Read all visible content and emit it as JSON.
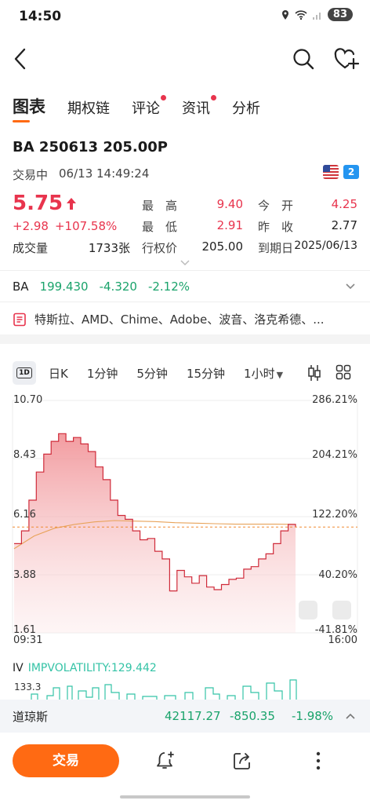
{
  "status_bar": {
    "time": "14:50",
    "wifi": "6",
    "battery": "83"
  },
  "tabs": [
    {
      "label": "图表",
      "active": true,
      "dot": false
    },
    {
      "label": "期权链",
      "active": false,
      "dot": false
    },
    {
      "label": "评论",
      "active": false,
      "dot": true
    },
    {
      "label": "资讯",
      "active": false,
      "dot": true
    },
    {
      "label": "分析",
      "active": false,
      "dot": false
    }
  ],
  "contract": {
    "symbol": "BA 250613 205.00P",
    "status": "交易中",
    "timestamp": "06/13 14:49:24",
    "badge": "2",
    "price": "5.75",
    "change": "+2.98",
    "change_pct": "+107.58%",
    "volume_label": "成交量",
    "volume": "1733张"
  },
  "stats": {
    "high_label": "最　高",
    "high": "9.40",
    "open_label": "今　开",
    "open": "4.25",
    "low_label": "最　低",
    "low": "2.91",
    "prev_close_label": "昨　收",
    "prev_close": "2.77",
    "strike_label": "行权价",
    "strike": "205.00",
    "expiry_label": "到期日",
    "expiry": "2025/06/13"
  },
  "underlying": {
    "symbol": "BA",
    "price": "199.430",
    "change": "-4.320",
    "change_pct": "-2.12%"
  },
  "related": {
    "text": "特斯拉、AMD、Chime、Adobe、波音、洛克希德、..."
  },
  "chart_tabs": {
    "day": "1D",
    "k": "日K",
    "m1": "1分钟",
    "m5": "5分钟",
    "m15": "15分钟",
    "h1": "1小时"
  },
  "chart_data": {
    "type": "area",
    "y_left_ticks": [
      "10.70",
      "8.43",
      "6.16",
      "3.88",
      "1.61"
    ],
    "y_right_ticks": [
      "286.21%",
      "204.21%",
      "122.20%",
      "40.20%",
      "-41.81%"
    ],
    "x_labels": [
      "09:31",
      "16:00"
    ],
    "ylim": [
      1.61,
      10.7
    ],
    "reference_line": 5.75,
    "series": [
      {
        "values": [
          5.1,
          5.6,
          6.8,
          7.9,
          8.6,
          9.1,
          9.4,
          9.1,
          9.25,
          9.0,
          8.7,
          8.1,
          7.6,
          6.8,
          6.2,
          6.05,
          5.6,
          5.25,
          5.3,
          4.8,
          4.5,
          3.25,
          4.05,
          3.8,
          3.55,
          3.85,
          3.4,
          3.3,
          3.5,
          3.7,
          3.75,
          4.1,
          4.2,
          4.5,
          4.7,
          5.1,
          5.6,
          5.85,
          5.75
        ]
      },
      {
        "values": [
          4.9,
          5.4,
          5.7,
          5.85,
          5.95,
          6.0,
          5.98,
          5.96,
          5.92,
          5.9,
          5.88,
          5.86,
          5.86,
          5.86,
          5.85
        ]
      }
    ]
  },
  "iv": {
    "label": "IV",
    "value": "IMPVOLATILITY:129.442",
    "max": "133.3"
  },
  "ticker": {
    "name": "道琼斯",
    "price": "42117.27",
    "change": "-850.35",
    "change_pct": "-1.98%"
  },
  "bottom": {
    "trade_label": "交易"
  },
  "colors": {
    "accent": "#ff6a13",
    "up": "#e8344d",
    "down": "#1aa36b"
  }
}
